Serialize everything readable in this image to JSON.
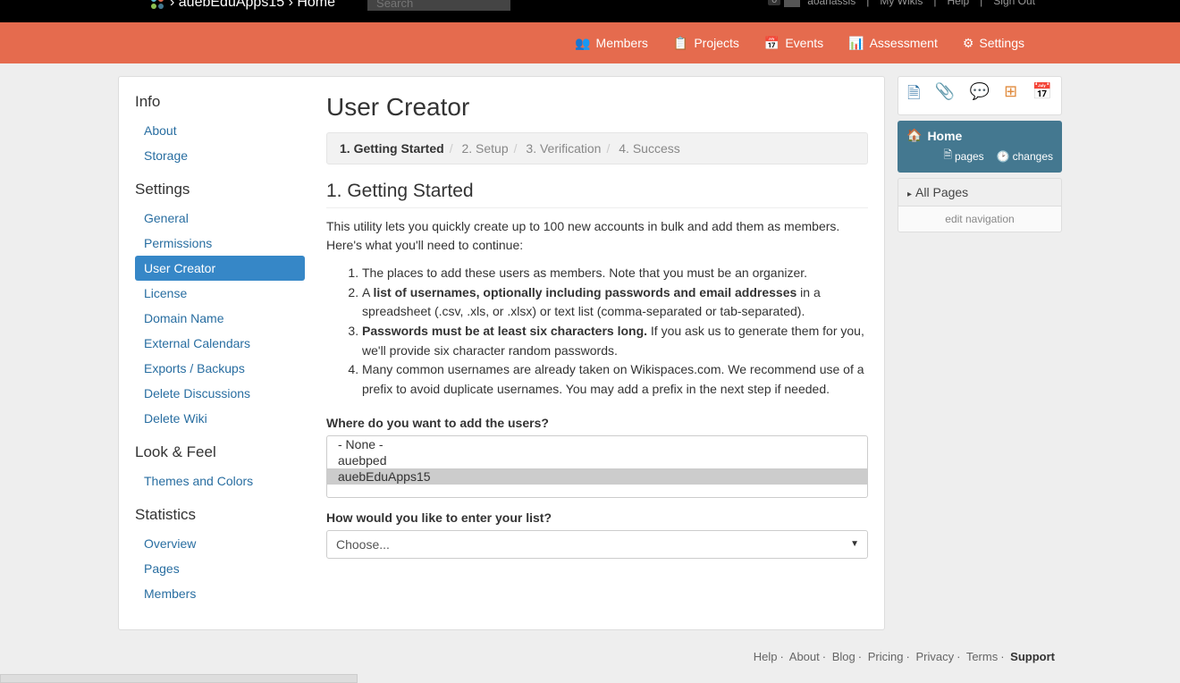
{
  "topbar": {
    "crumb_prefix": "›",
    "crumb_wiki": "auebEduApps15",
    "crumb_sep": "›",
    "crumb_page": "Home",
    "search_placeholder": "Search",
    "notif_count": "0",
    "user": "aoanassis",
    "mywikis": "My Wikis",
    "help": "Help",
    "signout": "Sign Out"
  },
  "nav": {
    "members": "Members",
    "projects": "Projects",
    "events": "Events",
    "assessment": "Assessment",
    "settings": "Settings"
  },
  "sidebar": {
    "info_head": "Info",
    "about": "About",
    "storage": "Storage",
    "settings_head": "Settings",
    "general": "General",
    "permissions": "Permissions",
    "user_creator": "User Creator",
    "license": "License",
    "domain": "Domain Name",
    "ext_cal": "External Calendars",
    "exports": "Exports / Backups",
    "del_disc": "Delete Discussions",
    "del_wiki": "Delete Wiki",
    "look_head": "Look & Feel",
    "themes": "Themes and Colors",
    "stats_head": "Statistics",
    "overview": "Overview",
    "pages": "Pages",
    "members": "Members"
  },
  "main": {
    "title": "User Creator",
    "step1": "1. Getting Started",
    "step2": "2. Setup",
    "step3": "3. Verification",
    "step4": "4. Success",
    "heading": "1. Getting Started",
    "intro": "This utility lets you quickly create up to 100 new accounts in bulk and add them as members. Here's what you'll need to continue:",
    "li1": "The places to add these users as members. Note that you must be an organizer.",
    "li2a": "A ",
    "li2b": "list of usernames, optionally including passwords and email addresses",
    "li2c": " in a spreadsheet (.csv, .xls, or .xlsx) or text list (comma-separated or tab-separated).",
    "li3a": "Passwords must be at least six characters long.",
    "li3b": " If you ask us to generate them for you, we'll provide six character random passwords.",
    "li4": "Many common usernames are already taken on Wikispaces.com. We recommend use of a prefix to avoid duplicate usernames. You may add a prefix in the next step if needed.",
    "q1": "Where do you want to add the users?",
    "opt_none": "- None -",
    "opt_auebped": "auebped",
    "opt_sel": "auebEduApps15",
    "q2": "How would you like to enter your list?",
    "choose": "Choose..."
  },
  "right": {
    "home": "Home",
    "pages": "pages",
    "changes": "changes",
    "allpages": "All Pages",
    "editnav": "edit navigation"
  },
  "footer": {
    "help": "Help",
    "about": "About",
    "blog": "Blog",
    "pricing": "Pricing",
    "privacy": "Privacy",
    "terms": "Terms",
    "support": "Support"
  }
}
